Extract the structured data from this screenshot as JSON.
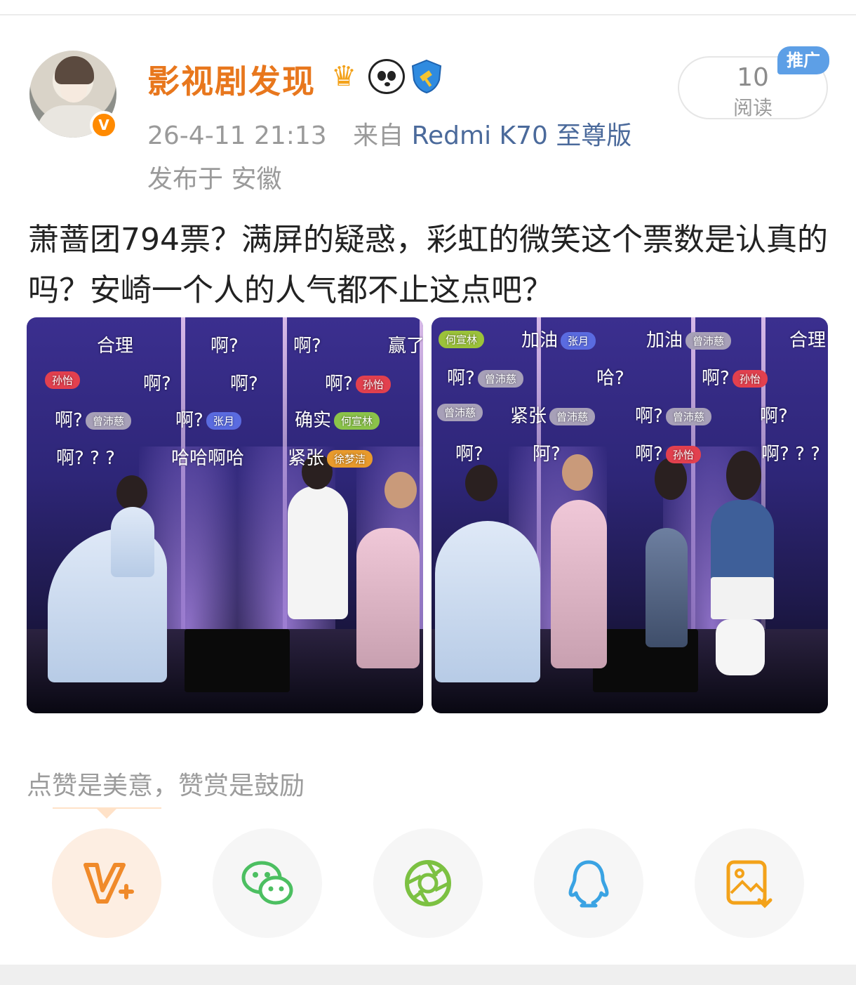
{
  "post": {
    "username": "影视剧发现",
    "timestamp": "26-4-11 21:13",
    "source_prefix": "来自",
    "device": "Redmi K70 至尊版",
    "location": "发布于 安徽",
    "read_count": "10",
    "read_label": "阅读",
    "promo_badge": "推广",
    "text": "萧蔷团794票？满屏的疑惑，彩虹的微笑这个票数是认真的吗？安崎一个人的人气都不止这点吧？"
  },
  "photos": {
    "left": {
      "danmaku": [
        {
          "text": "合理"
        },
        {
          "text": "啊?"
        },
        {
          "text": "啊?"
        },
        {
          "text": "赢了"
        },
        {
          "tag": "孙怡"
        },
        {
          "text": "啊?"
        },
        {
          "text": "啊?"
        },
        {
          "text": "啊?",
          "tag": "孙怡"
        },
        {
          "text": "啊?",
          "tag": "曾沛慈"
        },
        {
          "text": "啊?",
          "tag": "张月"
        },
        {
          "text": "确实",
          "tag": "何宣林"
        },
        {
          "text": "啊? ? ?"
        },
        {
          "text": "哈哈啊哈"
        },
        {
          "text": "紧张",
          "tag": "徐梦洁"
        }
      ]
    },
    "right": {
      "danmaku": [
        {
          "tag": "何宣林"
        },
        {
          "text": "加油",
          "tag": "张月"
        },
        {
          "text": "加油",
          "tag": "曾沛慈"
        },
        {
          "text": "合理"
        },
        {
          "text": "啊?",
          "tag": "曾沛慈"
        },
        {
          "text": "哈?"
        },
        {
          "text": "啊?",
          "tag": "孙怡"
        },
        {
          "tag": "曾沛慈"
        },
        {
          "text": "紧张",
          "tag": "曾沛慈"
        },
        {
          "text": "啊?",
          "tag": "曾沛慈"
        },
        {
          "text": "啊?"
        },
        {
          "text": "啊?"
        },
        {
          "text": "阿?"
        },
        {
          "text": "啊?",
          "tag": "孙怡"
        },
        {
          "text": "啊? ? ?"
        }
      ]
    }
  },
  "footer": {
    "hint": "点赞是美意，赞赏是鼓励"
  },
  "actions": [
    {
      "icon": "v-plus-icon",
      "color": "#f08a2a"
    },
    {
      "icon": "wechat-icon",
      "color": "#4cbf61"
    },
    {
      "icon": "moments-icon",
      "color": "#7cc142"
    },
    {
      "icon": "qq-icon",
      "color": "#3aa3e3"
    },
    {
      "icon": "save-image-icon",
      "color": "#f3a21a"
    }
  ]
}
